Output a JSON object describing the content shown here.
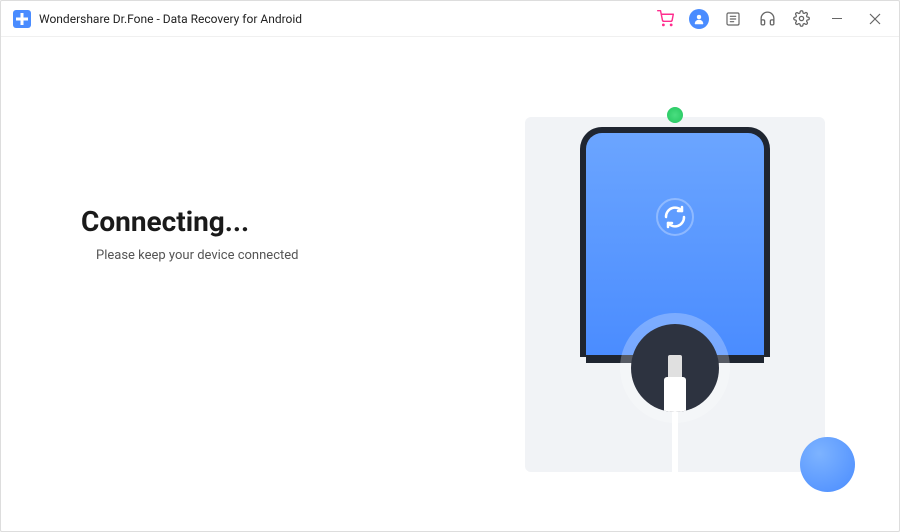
{
  "titlebar": {
    "app_title": "Wondershare Dr.Fone - Data Recovery for Android",
    "icons": {
      "cart": "cart-icon",
      "user": "user-icon",
      "feedback": "feedback-icon",
      "support": "support-icon",
      "settings": "settings-icon",
      "minimize": "minimize-icon",
      "close": "close-icon"
    }
  },
  "status": {
    "title": "Connecting...",
    "subtitle": "Please keep your device connected"
  },
  "colors": {
    "accent": "#4a8cff",
    "cart": "#ff2d8e",
    "illustration_bg": "#f1f3f6",
    "dark": "#2d3340"
  }
}
